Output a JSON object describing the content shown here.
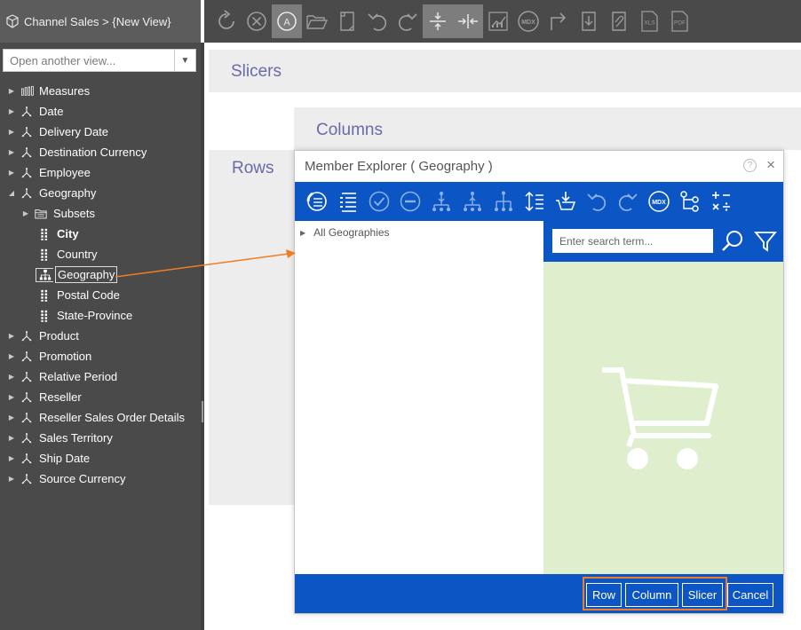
{
  "sidebar": {
    "breadcrumb": "Channel Sales > {New View}",
    "view_select": {
      "placeholder": "Open another view..."
    },
    "tree": [
      {
        "label": "Measures",
        "icon": "measures-icon",
        "level": 0,
        "expanded": false
      },
      {
        "label": "Date",
        "icon": "hierarchy-icon",
        "level": 0,
        "expanded": false
      },
      {
        "label": "Delivery Date",
        "icon": "hierarchy-icon",
        "level": 0,
        "expanded": false
      },
      {
        "label": "Destination Currency",
        "icon": "hierarchy-icon",
        "level": 0,
        "expanded": false
      },
      {
        "label": "Employee",
        "icon": "hierarchy-icon",
        "level": 0,
        "expanded": false
      },
      {
        "label": "Geography",
        "icon": "hierarchy-icon",
        "level": 0,
        "expanded": true
      },
      {
        "label": "Subsets",
        "icon": "folder-icon",
        "level": 1,
        "expanded": false
      },
      {
        "label": "City",
        "icon": "attribute-icon",
        "level": 1,
        "bold": true
      },
      {
        "label": "Country",
        "icon": "attribute-icon",
        "level": 1
      },
      {
        "label": "Geography",
        "icon": "tree-hierarchy-icon",
        "level": 1,
        "selected": true
      },
      {
        "label": "Postal Code",
        "icon": "attribute-icon",
        "level": 1
      },
      {
        "label": "State-Province",
        "icon": "attribute-icon",
        "level": 1
      },
      {
        "label": "Product",
        "icon": "hierarchy-icon",
        "level": 0,
        "expanded": false
      },
      {
        "label": "Promotion",
        "icon": "hierarchy-icon",
        "level": 0,
        "expanded": false
      },
      {
        "label": "Relative Period",
        "icon": "hierarchy-icon",
        "level": 0,
        "expanded": false
      },
      {
        "label": "Reseller",
        "icon": "hierarchy-icon",
        "level": 0,
        "expanded": false
      },
      {
        "label": "Reseller Sales Order Details",
        "icon": "hierarchy-icon",
        "level": 0,
        "expanded": false
      },
      {
        "label": "Sales Territory",
        "icon": "hierarchy-icon",
        "level": 0,
        "expanded": false
      },
      {
        "label": "Ship Date",
        "icon": "hierarchy-icon",
        "level": 0,
        "expanded": false
      },
      {
        "label": "Source Currency",
        "icon": "hierarchy-icon",
        "level": 0,
        "expanded": false
      }
    ]
  },
  "toolbar": {
    "buttons": [
      {
        "name": "refresh-icon"
      },
      {
        "name": "cancel-query-icon"
      },
      {
        "name": "auto-execute-icon",
        "active": true
      },
      {
        "name": "open-folder-icon"
      },
      {
        "name": "new-page-icon"
      },
      {
        "name": "undo-icon"
      },
      {
        "name": "redo-icon"
      },
      {
        "name": "expand-icon",
        "active": true
      },
      {
        "name": "collapse-icon",
        "active": true
      },
      {
        "name": "chart-icon"
      },
      {
        "name": "mdx-icon",
        "text": "MDX"
      },
      {
        "name": "drillthrough-icon"
      },
      {
        "name": "export-icon"
      },
      {
        "name": "attach-icon"
      },
      {
        "name": "export-xls-icon",
        "text": "XLS"
      },
      {
        "name": "export-pdf-icon",
        "text": "PDF"
      }
    ]
  },
  "canvas": {
    "slicers_label": "Slicers",
    "columns_label": "Columns",
    "rows_label": "Rows"
  },
  "member_explorer": {
    "title": "Member Explorer ( Geography )",
    "help_glyph": "?",
    "close_glyph": "×",
    "toolbar": [
      "show-all-icon",
      "list-icon",
      "select-all-icon",
      "deselect-icon",
      "level-down-icon",
      "level-up-icon",
      "hierarchy-icon",
      "sort-icon",
      "basket-icon",
      "undo-icon",
      "redo-icon",
      "mdx-icon",
      "structure-icon",
      "calculator-icon"
    ],
    "mdx_text": "MDX",
    "tree_root": "All Geographies",
    "search": {
      "placeholder": "Enter search term..."
    },
    "buttons": {
      "row": "Row",
      "column": "Column",
      "slicer": "Slicer",
      "cancel": "Cancel"
    },
    "accent_color": "#0b55c4",
    "basket_bg": "#dfeecd",
    "highlight_color": "#f07c24"
  }
}
